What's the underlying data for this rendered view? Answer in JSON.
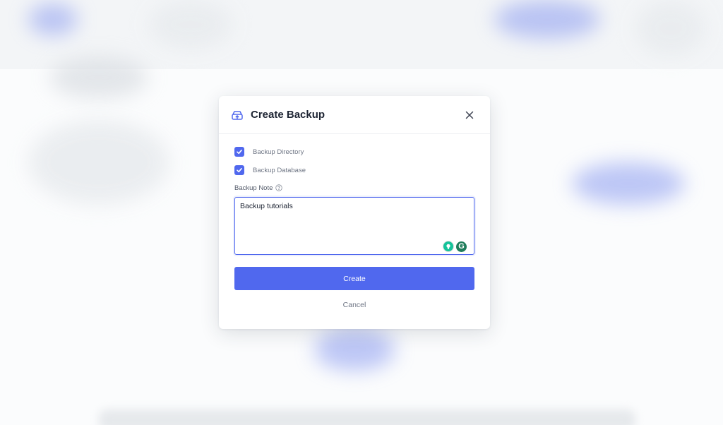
{
  "modal": {
    "title": "Create Backup",
    "header_icon": "backup-drive-icon",
    "close_icon": "close-icon",
    "options": [
      {
        "label": "Backup Directory",
        "checked": true
      },
      {
        "label": "Backup Database",
        "checked": true
      }
    ],
    "note_label": "Backup Note",
    "note_help_icon": "help-circle-icon",
    "note_value": "Backup tutorials",
    "create_label": "Create",
    "cancel_label": "Cancel"
  },
  "colors": {
    "accent": "#5068ee",
    "title": "#1d2433",
    "muted": "#6e7584",
    "grammarly_green": "#15c39a",
    "grammarly_dark": "#1f7c5b"
  }
}
